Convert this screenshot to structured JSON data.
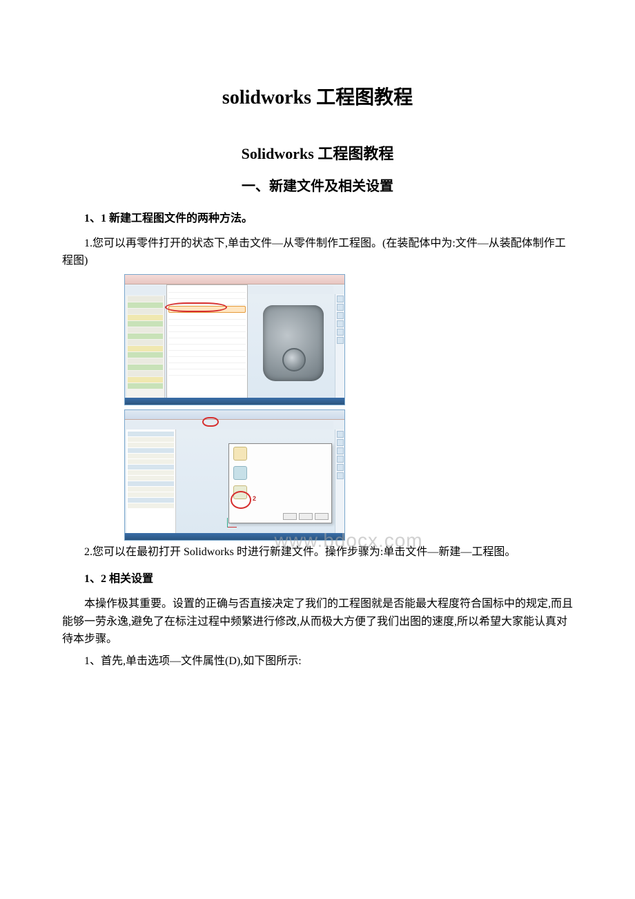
{
  "title_main": "solidworks 工程图教程",
  "title_sub": "Solidworks 工程图教程",
  "section1_title": "一、新建文件及相关设置",
  "h1_1": "1、1 新建工程图文件的两种方法。",
  "p_method1": "1.您可以再零件打开的状态下,单击文件—从零件制作工程图。(在装配体中为:文件—从装配体制作工程图)",
  "p_method2": "2.您可以在最初打开 Solidworks 时进行新建文件。操作步骤为:单击文件—新建—工程图。",
  "h1_2": "1、2 相关设置",
  "p_settings": "本操作极其重要。设置的正确与否直接决定了我们的工程图就是否能最大程度符合国标中的规定,而且能够一劳永逸,避免了在标注过程中频繁进行修改,从而极大方便了我们出图的速度,所以希望大家能认真对待本步骤。",
  "p_step1": "1、首先,单击选项—文件属性(D),如下图所示:",
  "watermark": "www.bdocx.com",
  "dialog_marker": "2"
}
